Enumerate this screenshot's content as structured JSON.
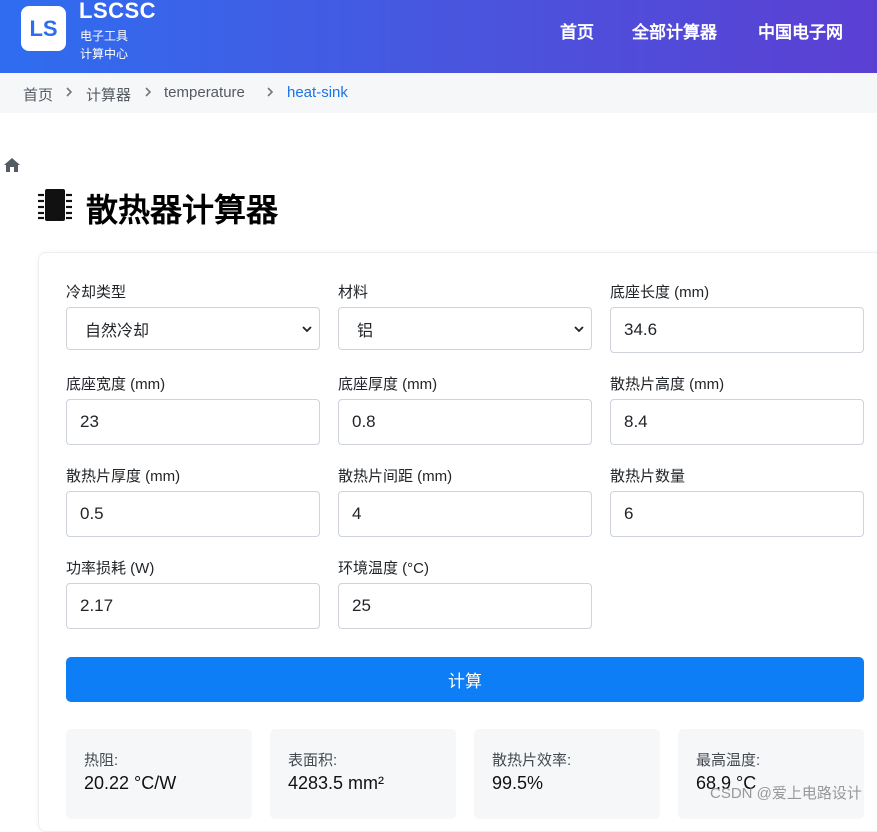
{
  "header": {
    "logo_text": "LS",
    "brand": "LSCSC",
    "brand_sub1": "电子工具",
    "brand_sub2": "计算中心",
    "nav": [
      "首页",
      "全部计算器",
      "中国电子网"
    ]
  },
  "breadcrumb": {
    "items": [
      "首页",
      "计算器",
      "temperature",
      "heat-sink"
    ]
  },
  "page_title": "散热器计算器",
  "form": {
    "cooling_type": {
      "label": "冷却类型",
      "value": "自然冷却"
    },
    "material": {
      "label": "材料",
      "value": "铝"
    },
    "base_length": {
      "label": "底座长度 (mm)",
      "value": "34.6"
    },
    "base_width": {
      "label": "底座宽度 (mm)",
      "value": "23"
    },
    "base_thickness": {
      "label": "底座厚度 (mm)",
      "value": "0.8"
    },
    "fin_height": {
      "label": "散热片高度 (mm)",
      "value": "8.4"
    },
    "fin_thickness": {
      "label": "散热片厚度 (mm)",
      "value": "0.5"
    },
    "fin_spacing": {
      "label": "散热片间距 (mm)",
      "value": "4"
    },
    "fin_count": {
      "label": "散热片数量",
      "value": "6"
    },
    "power": {
      "label": "功率损耗 (W)",
      "value": "2.17"
    },
    "ambient_temp": {
      "label": "环境温度 (°C)",
      "value": "25"
    }
  },
  "calculate_label": "计算",
  "results": [
    {
      "label": "热阻:",
      "value": "20.22 °C/W"
    },
    {
      "label": "表面积:",
      "value": "4283.5 mm²"
    },
    {
      "label": "散热片效率:",
      "value": "99.5%"
    },
    {
      "label": "最高温度:",
      "value": "68.9 °C"
    }
  ],
  "watermark": "CSDN @爱上电路设计",
  "colors": {
    "accent": "#0d7ef5",
    "nav_gradient_start": "#2f6df0",
    "nav_gradient_end": "#5b3fd3"
  }
}
